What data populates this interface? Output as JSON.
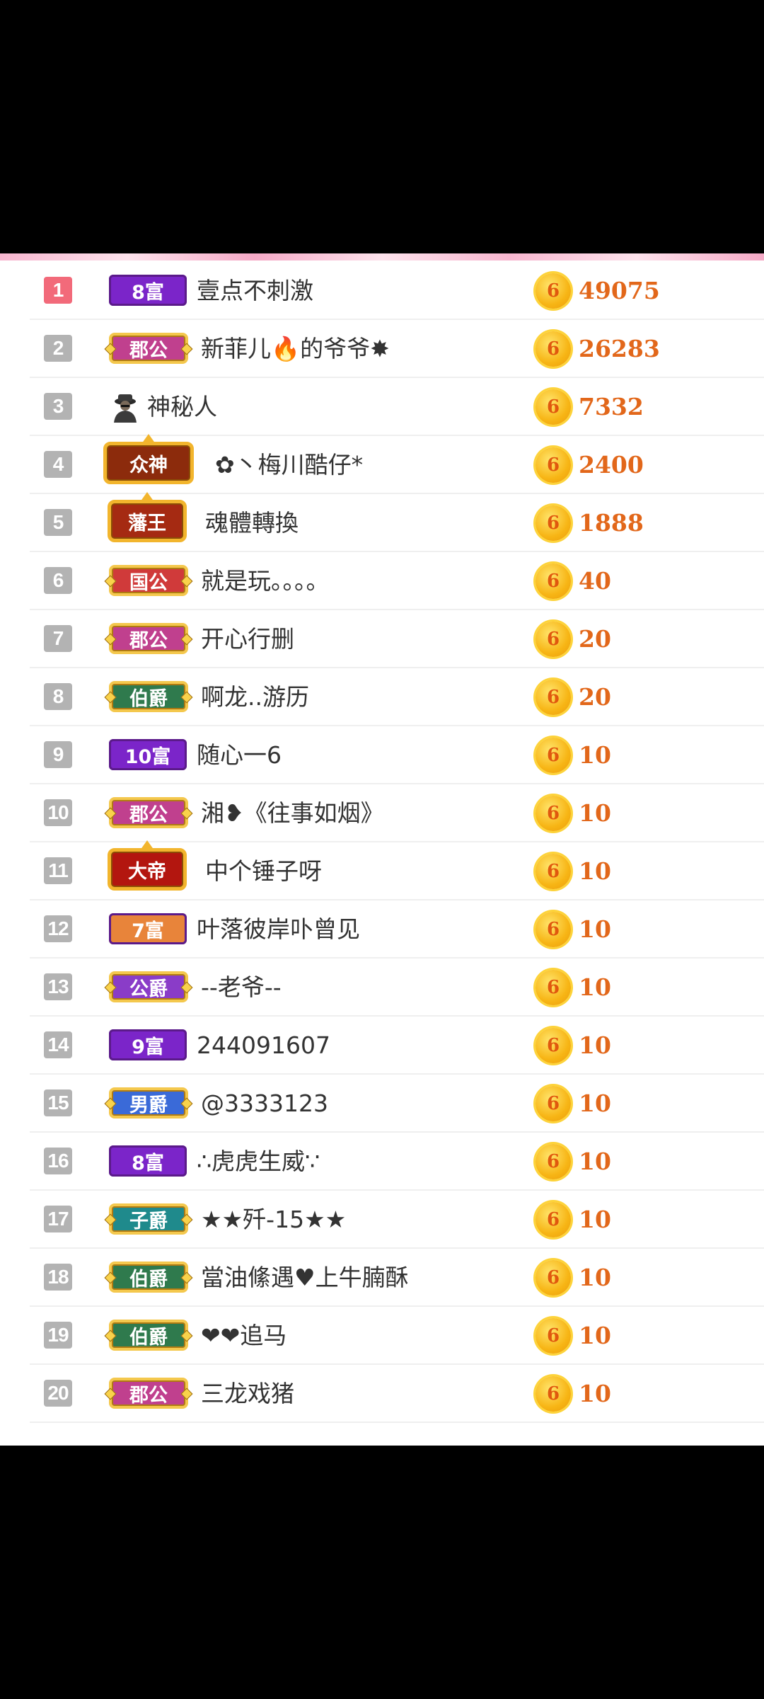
{
  "currency_icon_label": "6",
  "rows": [
    {
      "rank": "1",
      "badge": "8富",
      "badge_color": "#7b25c9",
      "badge_type": "fu",
      "name": "壹点不刺激",
      "amount": "49075"
    },
    {
      "rank": "2",
      "badge": "郡公",
      "badge_color": "#c0408e",
      "badge_type": "noble",
      "name": "新菲儿🔥的爷爷✸",
      "amount": "26283"
    },
    {
      "rank": "3",
      "badge": "",
      "badge_color": "",
      "badge_type": "avatar",
      "name": "神秘人",
      "amount": "7332"
    },
    {
      "rank": "4",
      "badge": "众神",
      "badge_color": "#8c2b0c",
      "badge_type": "crown",
      "name": "✿丶梅川酷仔*",
      "amount": "2400"
    },
    {
      "rank": "5",
      "badge": "藩王",
      "badge_color": "#a52a12",
      "badge_type": "crown",
      "name": "魂體轉換",
      "amount": "1888"
    },
    {
      "rank": "6",
      "badge": "国公",
      "badge_color": "#d03a3a",
      "badge_type": "noble",
      "name": "就是玩。。。。",
      "amount": "40"
    },
    {
      "rank": "7",
      "badge": "郡公",
      "badge_color": "#c0408e",
      "badge_type": "noble",
      "name": "开心行删",
      "amount": "20"
    },
    {
      "rank": "8",
      "badge": "伯爵",
      "badge_color": "#2f7a4d",
      "badge_type": "noble",
      "name": "啊龙..游历",
      "amount": "20"
    },
    {
      "rank": "9",
      "badge": "10富",
      "badge_color": "#7b25c9",
      "badge_type": "fu",
      "name": "随心一6",
      "amount": "10"
    },
    {
      "rank": "10",
      "badge": "郡公",
      "badge_color": "#c0408e",
      "badge_type": "noble",
      "name": "湘❥《往事如烟》",
      "amount": "10"
    },
    {
      "rank": "11",
      "badge": "大帝",
      "badge_color": "#b3160f",
      "badge_type": "crown",
      "name": "中个锤子呀",
      "amount": "10"
    },
    {
      "rank": "12",
      "badge": "7富",
      "badge_color": "#e8843a",
      "badge_type": "fu",
      "name": "叶落彼岸卟曾见",
      "amount": "10"
    },
    {
      "rank": "13",
      "badge": "公爵",
      "badge_color": "#8a3cc8",
      "badge_type": "noble",
      "name": "--老爷--",
      "amount": "10"
    },
    {
      "rank": "14",
      "badge": "9富",
      "badge_color": "#7b25c9",
      "badge_type": "fu",
      "name": "244091607",
      "amount": "10"
    },
    {
      "rank": "15",
      "badge": "男爵",
      "badge_color": "#3a6ad8",
      "badge_type": "noble",
      "name": "@3333123",
      "amount": "10"
    },
    {
      "rank": "16",
      "badge": "8富",
      "badge_color": "#7b25c9",
      "badge_type": "fu",
      "name": "∴虎虎生威∵",
      "amount": "10"
    },
    {
      "rank": "17",
      "badge": "子爵",
      "badge_color": "#1f8a8c",
      "badge_type": "noble",
      "name": "★★歼-15★★",
      "amount": "10"
    },
    {
      "rank": "18",
      "badge": "伯爵",
      "badge_color": "#2f7a4d",
      "badge_type": "noble",
      "name": "當油絛遇♥上牛腩酥",
      "amount": "10"
    },
    {
      "rank": "19",
      "badge": "伯爵",
      "badge_color": "#2f7a4d",
      "badge_type": "noble",
      "name": "❤❤追马",
      "amount": "10"
    },
    {
      "rank": "20",
      "badge": "郡公",
      "badge_color": "#c0408e",
      "badge_type": "noble",
      "name": "三龙戏猪",
      "amount": "10"
    }
  ]
}
